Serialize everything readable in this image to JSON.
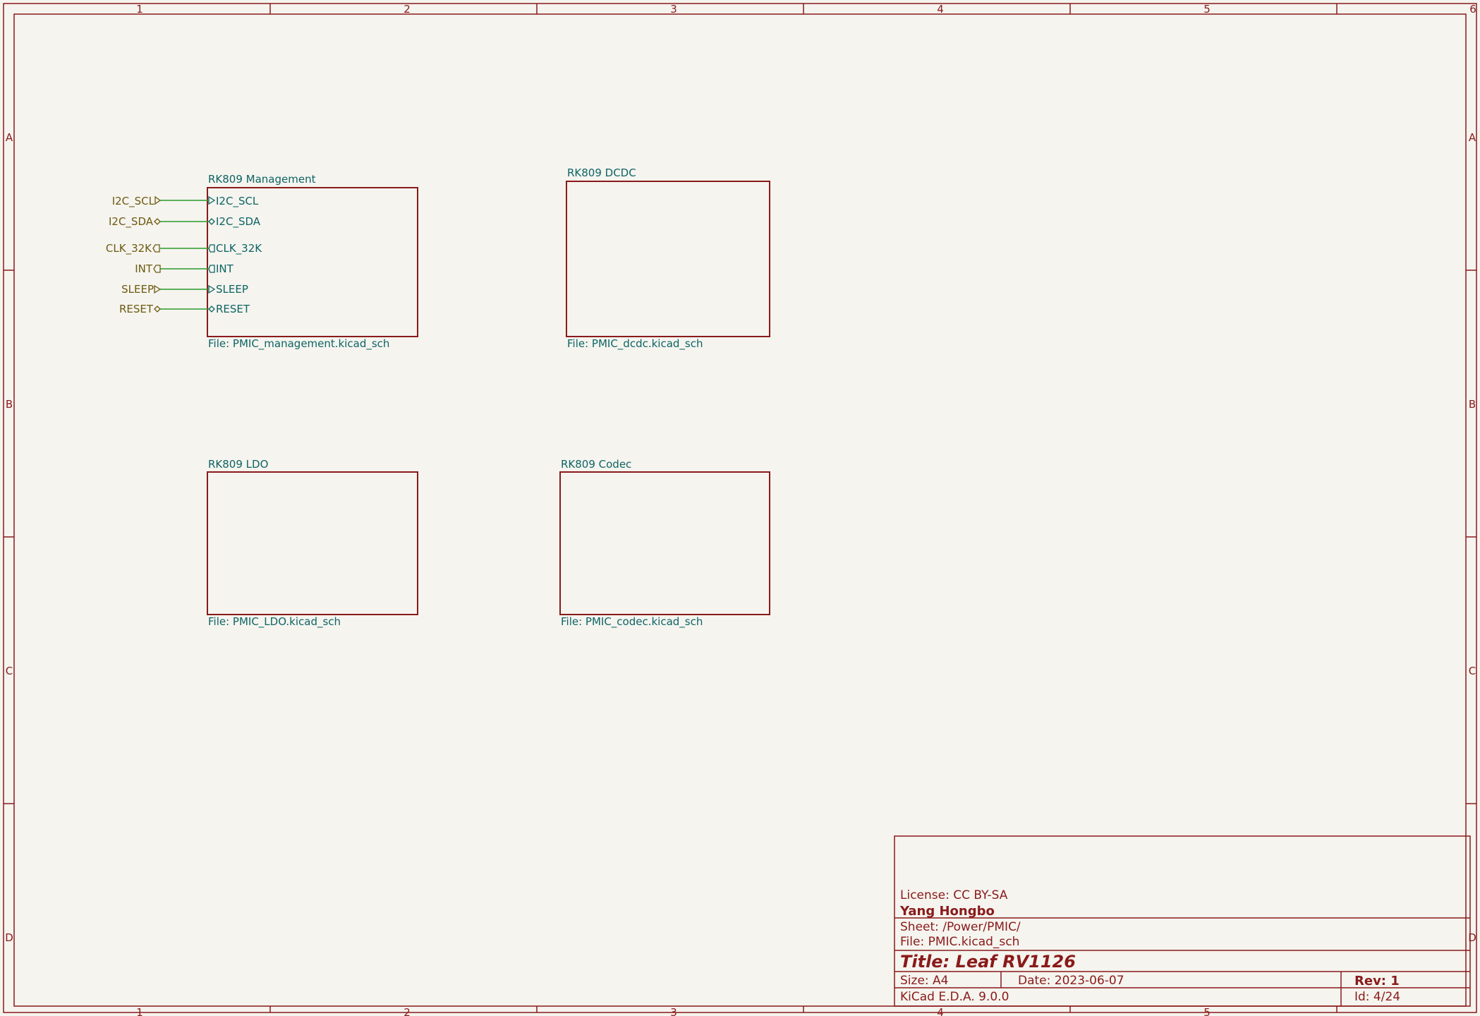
{
  "zones": {
    "columns": [
      "1",
      "2",
      "3",
      "4",
      "5",
      "6"
    ],
    "rows": [
      "A",
      "B",
      "C",
      "D"
    ]
  },
  "sheets": [
    {
      "name": "RK809 Management",
      "file": "File: PMIC_management.kicad_sch",
      "pins": [
        {
          "label": "I2C_SCL",
          "shape": "input"
        },
        {
          "label": "I2C_SDA",
          "shape": "bidir"
        },
        {
          "label": "CLK_32K",
          "shape": "output"
        },
        {
          "label": "INT",
          "shape": "output"
        },
        {
          "label": "SLEEP",
          "shape": "input"
        },
        {
          "label": "RESET",
          "shape": "bidir"
        }
      ]
    },
    {
      "name": "RK809 DCDC",
      "file": "File: PMIC_dcdc.kicad_sch",
      "pins": []
    },
    {
      "name": "RK809 LDO",
      "file": "File: PMIC_LDO.kicad_sch",
      "pins": []
    },
    {
      "name": "RK809 Codec",
      "file": "File: PMIC_codec.kicad_sch",
      "pins": []
    }
  ],
  "global_labels": [
    "I2C_SCL",
    "I2C_SDA",
    "CLK_32K",
    "INT",
    "SLEEP",
    "RESET"
  ],
  "title_block": {
    "license": "License: CC BY-SA",
    "company": "Yang Hongbo",
    "sheet": "Sheet: /Power/PMIC/",
    "file": "File: PMIC.kicad_sch",
    "title": "Title: Leaf RV1126",
    "size": "Size: A4",
    "date": "Date: 2023-06-07",
    "rev": "Rev: 1",
    "tool": "KiCad E.D.A. 9.0.0",
    "id": "Id: 4/24"
  },
  "colors": {
    "frame": "#8a1a1a",
    "sheet_text": "#0e6464",
    "label_text": "#6e5a10",
    "wire": "#2a9a2a",
    "background": "#f5f4ef"
  }
}
